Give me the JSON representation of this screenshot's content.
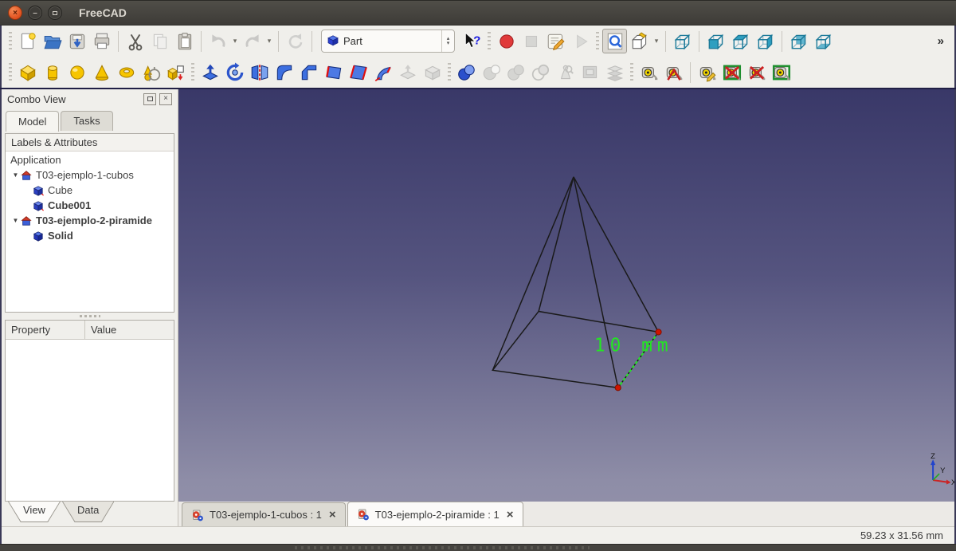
{
  "window": {
    "title": "FreeCAD",
    "controls": [
      "close",
      "minimize",
      "maximize"
    ]
  },
  "toolbars": {
    "row1": [
      {
        "type": "handle"
      },
      {
        "type": "button",
        "name": "new-document-button",
        "icon": "new-document-icon"
      },
      {
        "type": "button",
        "name": "open-button",
        "icon": "open-folder-icon"
      },
      {
        "type": "button",
        "name": "save-button",
        "icon": "save-icon"
      },
      {
        "type": "button",
        "name": "print-button",
        "icon": "print-icon"
      },
      {
        "type": "sep"
      },
      {
        "type": "button",
        "name": "cut-button",
        "icon": "cut-icon"
      },
      {
        "type": "button",
        "name": "copy-button",
        "icon": "copy-icon",
        "disabled": true
      },
      {
        "type": "button",
        "name": "paste-button",
        "icon": "paste-icon"
      },
      {
        "type": "sep"
      },
      {
        "type": "button",
        "name": "undo-button",
        "icon": "undo-icon",
        "disabled": true
      },
      {
        "type": "dropdown",
        "name": "undo-dropdown"
      },
      {
        "type": "button",
        "name": "redo-button",
        "icon": "redo-icon",
        "disabled": true
      },
      {
        "type": "dropdown",
        "name": "redo-dropdown"
      },
      {
        "type": "sep"
      },
      {
        "type": "button",
        "name": "refresh-button",
        "icon": "refresh-icon",
        "disabled": true
      },
      {
        "type": "sep"
      },
      {
        "type": "combo",
        "name": "workbench-selector",
        "icon": "part-workbench-icon",
        "label": "Part"
      },
      {
        "type": "button",
        "name": "whats-this-button",
        "icon": "whats-this-icon"
      },
      {
        "type": "handle"
      },
      {
        "type": "button",
        "name": "macro-record-button",
        "icon": "macro-record-icon"
      },
      {
        "type": "button",
        "name": "macro-stop-button",
        "icon": "macro-stop-icon",
        "disabled": true
      },
      {
        "type": "button",
        "name": "macro-edit-button",
        "icon": "macro-edit-icon"
      },
      {
        "type": "button",
        "name": "macro-play-button",
        "icon": "macro-play-icon",
        "disabled": true
      },
      {
        "type": "handle"
      },
      {
        "type": "button",
        "name": "fit-all-button",
        "icon": "fit-all-icon",
        "pressed": true
      },
      {
        "type": "button",
        "name": "draw-style-button",
        "icon": "draw-style-icon"
      },
      {
        "type": "dropdown",
        "name": "draw-style-dropdown"
      },
      {
        "type": "sep"
      },
      {
        "type": "button",
        "name": "view-axonometric-button",
        "icon": "view-axonometric-icon"
      },
      {
        "type": "sep"
      },
      {
        "type": "button",
        "name": "view-front-button",
        "icon": "view-front-icon"
      },
      {
        "type": "button",
        "name": "view-top-button",
        "icon": "view-top-icon"
      },
      {
        "type": "button",
        "name": "view-right-button",
        "icon": "view-right-icon"
      },
      {
        "type": "sep"
      },
      {
        "type": "button",
        "name": "view-rear-button",
        "icon": "view-rear-icon"
      },
      {
        "type": "button",
        "name": "view-bottom-button",
        "icon": "view-bottom-icon"
      },
      {
        "type": "overflow",
        "name": "toolbar-overflow",
        "label": "»"
      }
    ],
    "row2": [
      {
        "type": "handle"
      },
      {
        "type": "button",
        "name": "part-box-button",
        "icon": "part-box-icon"
      },
      {
        "type": "button",
        "name": "part-cylinder-button",
        "icon": "part-cylinder-icon"
      },
      {
        "type": "button",
        "name": "part-sphere-button",
        "icon": "part-sphere-icon"
      },
      {
        "type": "button",
        "name": "part-cone-button",
        "icon": "part-cone-icon"
      },
      {
        "type": "button",
        "name": "part-torus-button",
        "icon": "part-torus-icon"
      },
      {
        "type": "button",
        "name": "part-primitives-button",
        "icon": "part-primitives-icon"
      },
      {
        "type": "button",
        "name": "shape-builder-button",
        "icon": "shape-builder-icon"
      },
      {
        "type": "handle"
      },
      {
        "type": "button",
        "name": "extrude-button",
        "icon": "extrude-icon"
      },
      {
        "type": "button",
        "name": "revolve-button",
        "icon": "revolve-icon"
      },
      {
        "type": "button",
        "name": "mirror-button",
        "icon": "mirror-icon"
      },
      {
        "type": "button",
        "name": "fillet-button",
        "icon": "fillet-icon"
      },
      {
        "type": "button",
        "name": "chamfer-button",
        "icon": "chamfer-icon"
      },
      {
        "type": "button",
        "name": "make-face-button",
        "icon": "make-face-icon"
      },
      {
        "type": "button",
        "name": "ruled-surface-button",
        "icon": "ruled-surface-icon"
      },
      {
        "type": "button",
        "name": "sweep-button",
        "icon": "sweep-icon"
      },
      {
        "type": "button",
        "name": "offset-button",
        "icon": "offset-icon",
        "disabled": true
      },
      {
        "type": "button",
        "name": "thickness-button",
        "icon": "thickness-icon",
        "disabled": true
      },
      {
        "type": "handle"
      },
      {
        "type": "button",
        "name": "boolean-button",
        "icon": "boolean-icon"
      },
      {
        "type": "button",
        "name": "boolean-cut-button",
        "icon": "boolean-cut-icon",
        "disabled": true
      },
      {
        "type": "button",
        "name": "boolean-union-button",
        "icon": "boolean-union-icon",
        "disabled": true
      },
      {
        "type": "button",
        "name": "boolean-intersection-button",
        "icon": "boolean-intersection-icon",
        "disabled": true
      },
      {
        "type": "button",
        "name": "check-geometry-button",
        "icon": "check-geometry-icon",
        "disabled": true
      },
      {
        "type": "button",
        "name": "section-button",
        "icon": "section-icon",
        "disabled": true
      },
      {
        "type": "button",
        "name": "cross-sections-button",
        "icon": "cross-sections-icon",
        "disabled": true
      },
      {
        "type": "handle"
      },
      {
        "type": "button",
        "name": "measure-linear-button",
        "icon": "measure-linear-icon"
      },
      {
        "type": "button",
        "name": "measure-angular-button",
        "icon": "measure-angular-icon"
      },
      {
        "type": "sep"
      },
      {
        "type": "button",
        "name": "measure-refresh-button",
        "icon": "measure-refresh-icon"
      },
      {
        "type": "button",
        "name": "measure-clear-all-button",
        "icon": "measure-clear-all-icon"
      },
      {
        "type": "button",
        "name": "measure-toggle-all-button",
        "icon": "measure-toggle-all-icon"
      },
      {
        "type": "button",
        "name": "measure-toggle-3d-button",
        "icon": "measure-toggle-3d-icon"
      }
    ]
  },
  "combo_view": {
    "title": "Combo View",
    "tabs": [
      {
        "label": "Model",
        "active": true
      },
      {
        "label": "Tasks",
        "active": false
      }
    ],
    "tree_header": "Labels & Attributes",
    "tree": [
      {
        "name": "tree-item-application",
        "label": "Application",
        "level": 0,
        "icon": null,
        "expander": false,
        "bold": false
      },
      {
        "name": "tree-item-doc-cubos",
        "label": "T03-ejemplo-1-cubos",
        "level": 1,
        "icon": "document-icon",
        "expander": true,
        "bold": false
      },
      {
        "name": "tree-item-cube",
        "label": "Cube",
        "level": 2,
        "icon": "part-cube-icon",
        "expander": false,
        "bold": false
      },
      {
        "name": "tree-item-cube001",
        "label": "Cube001",
        "level": 2,
        "icon": "part-cube-icon",
        "expander": false,
        "bold": true
      },
      {
        "name": "tree-item-doc-piramide",
        "label": "T03-ejemplo-2-piramide",
        "level": 1,
        "icon": "document-icon",
        "expander": true,
        "bold": true
      },
      {
        "name": "tree-item-solid",
        "label": "Solid",
        "level": 2,
        "icon": "solid-icon",
        "expander": false,
        "bold": true
      }
    ],
    "property_table": {
      "columns": [
        "Property",
        "Value"
      ],
      "rows": []
    },
    "bottom_tabs": [
      {
        "label": "View",
        "active": true
      },
      {
        "label": "Data",
        "active": false
      }
    ]
  },
  "viewport": {
    "object": "wireframe pyramid with square base",
    "measurement": {
      "label": "10 mm",
      "color": "#24e424"
    },
    "axis": {
      "x": "X",
      "y": "Y",
      "z": "Z"
    },
    "background": {
      "top": "#393868",
      "bottom": "#8e8da7"
    }
  },
  "mdi_tabs": [
    {
      "label": "T03-ejemplo-1-cubos : 1",
      "active": false
    },
    {
      "label": "T03-ejemplo-2-piramide : 1",
      "active": true
    }
  ],
  "status_bar": {
    "dimensions": "59.23 x 31.56 mm"
  }
}
